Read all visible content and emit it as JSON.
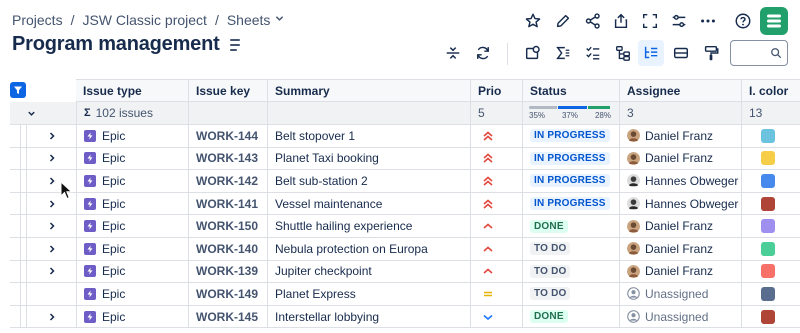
{
  "breadcrumb": {
    "projects": "Projects",
    "project": "JSW Classic project",
    "sheets": "Sheets"
  },
  "page_title": "Program management",
  "columns": [
    "Issue type",
    "Issue key",
    "Summary",
    "Prio",
    "Status",
    "Assignee",
    "I. color"
  ],
  "summary": {
    "count_label": "102 issues",
    "prio": "5",
    "assignee": "3",
    "color": "13",
    "progress": [
      {
        "label": "35%",
        "value": 0.35,
        "color": "#b3b9c4"
      },
      {
        "label": "37%",
        "value": 0.37,
        "color": "#0c66e4"
      },
      {
        "label": "28%",
        "value": 0.28,
        "color": "#22a06b"
      }
    ]
  },
  "search": {
    "value": ""
  },
  "colors": {
    "accent": "#0c66e4",
    "logo": "#22a06b",
    "epic": "#6e5dc6"
  },
  "rows": [
    {
      "type": "Epic",
      "key": "WORK-144",
      "summary": "Belt stopover 1",
      "prio": "highest",
      "status": "IN PROGRESS",
      "assignee": "Daniel Franz",
      "avatar": "daniel",
      "color": "#6cc3e0",
      "expandable": true
    },
    {
      "type": "Epic",
      "key": "WORK-143",
      "summary": "Planet Taxi booking",
      "prio": "highest",
      "status": "IN PROGRESS",
      "assignee": "Daniel Franz",
      "avatar": "daniel",
      "color": "#f5cd47",
      "expandable": true
    },
    {
      "type": "Epic",
      "key": "WORK-142",
      "summary": "Belt sub-station 2",
      "prio": "highest",
      "status": "IN PROGRESS",
      "assignee": "Hannes Obweger",
      "avatar": "hannes",
      "color": "#4688ec",
      "expandable": true
    },
    {
      "type": "Epic",
      "key": "WORK-141",
      "summary": "Vessel maintenance",
      "prio": "highest",
      "status": "IN PROGRESS",
      "assignee": "Hannes Obweger",
      "avatar": "hannes",
      "color": "#ae4536",
      "expandable": true
    },
    {
      "type": "Epic",
      "key": "WORK-150",
      "summary": "Shuttle hailing experience",
      "prio": "high",
      "status": "DONE",
      "assignee": "Daniel Franz",
      "avatar": "daniel",
      "color": "#9f8fef",
      "expandable": true
    },
    {
      "type": "Epic",
      "key": "WORK-140",
      "summary": "Nebula protection on Europa",
      "prio": "high",
      "status": "TO DO",
      "assignee": "Daniel Franz",
      "avatar": "daniel",
      "color": "#4bce97",
      "expandable": true
    },
    {
      "type": "Epic",
      "key": "WORK-139",
      "summary": "Jupiter checkpoint",
      "prio": "high",
      "status": "TO DO",
      "assignee": "Daniel Franz",
      "avatar": "daniel",
      "color": "#f87168",
      "expandable": true
    },
    {
      "type": "Epic",
      "key": "WORK-149",
      "summary": "Planet Express",
      "prio": "medium",
      "status": "TO DO",
      "assignee": "Unassigned",
      "avatar": "none",
      "color": "#596e8f",
      "expandable": false
    },
    {
      "type": "Epic",
      "key": "WORK-145",
      "summary": "Interstellar lobbying",
      "prio": "low",
      "status": "DONE",
      "assignee": "Unassigned",
      "avatar": "none",
      "color": "#ae4536",
      "expandable": true
    }
  ],
  "status_styles": {
    "IN PROGRESS": {
      "bg": "#e9f2ff",
      "fg": "#0055cc"
    },
    "DONE": {
      "bg": "#dcfff1",
      "fg": "#216e4e"
    },
    "TO DO": {
      "bg": "#f1f2f4",
      "fg": "#44546f"
    }
  },
  "icons": {
    "top": [
      "star-icon",
      "edit-icon",
      "share-icon",
      "export-icon",
      "fullscreen-icon",
      "settings-sliders-icon",
      "more-icon",
      "help-icon"
    ],
    "toolbar": [
      "collapse-rows-icon",
      "refresh-icon",
      "view-icon",
      "sum-icon",
      "checklist-icon",
      "hierarchy-icon",
      "structure-icon",
      "rows-icon",
      "format-painter-icon"
    ]
  }
}
